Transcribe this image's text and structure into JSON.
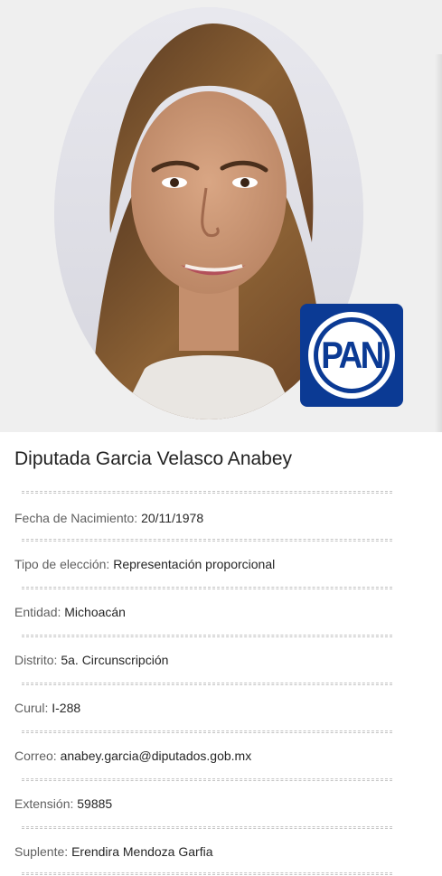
{
  "profile": {
    "portrait_alt": "Retrato de la diputada",
    "party_logo": {
      "text": "PAN",
      "color": "#0b3a94"
    },
    "name": "Diputada Garcia Velasco Anabey",
    "fields": [
      {
        "label": "Fecha de Nacimiento:",
        "value": "20/11/1978"
      },
      {
        "label": "Tipo de elección:",
        "value": "Representación proporcional"
      },
      {
        "label": "Entidad:",
        "value": "Michoacán"
      },
      {
        "label": "Distrito:",
        "value": "5a. Circunscripción"
      },
      {
        "label": "Curul:",
        "value": "I-288"
      },
      {
        "label": "Correo:",
        "value": "anabey.garcia@diputados.gob.mx"
      },
      {
        "label": "Extensión:",
        "value": "59885"
      },
      {
        "label": "Suplente:",
        "value": "Erendira Mendoza Garfia"
      }
    ]
  },
  "colors": {
    "photo_background": "#efefef",
    "party_blue": "#0b3a94",
    "divider": "#c4c4c4"
  }
}
